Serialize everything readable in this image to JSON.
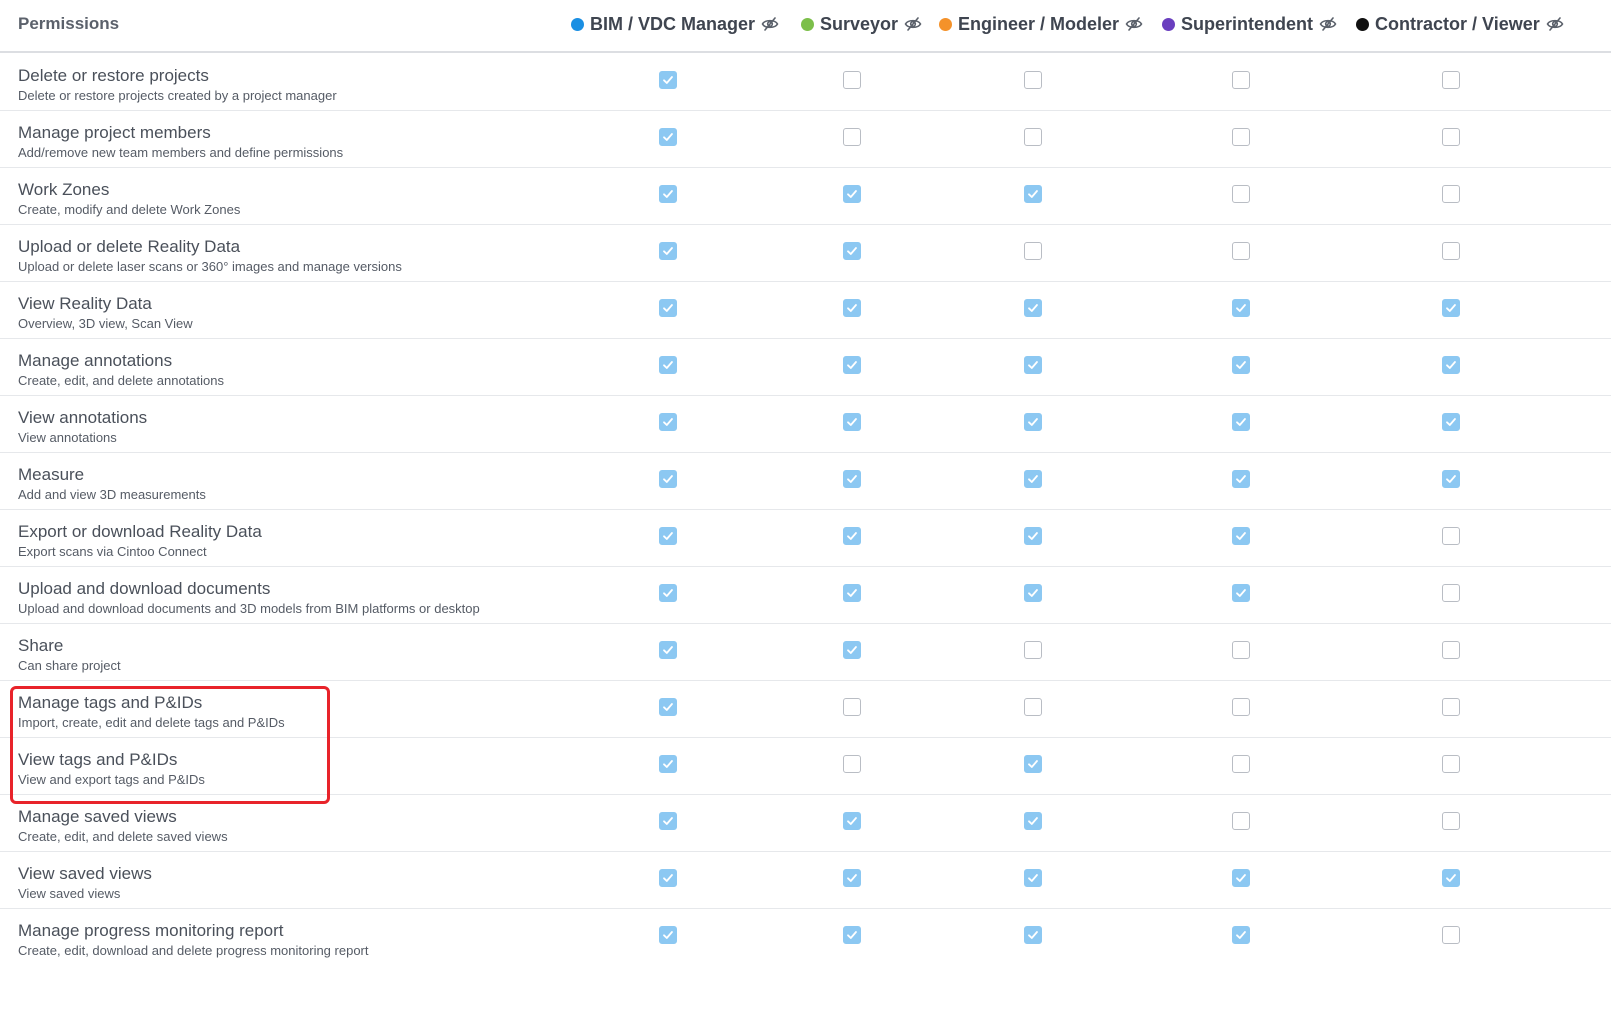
{
  "header": {
    "title": "Permissions",
    "roles": [
      {
        "name": "BIM / VDC Manager",
        "color": "#1a8fe3",
        "icon": "eye-slash-icon"
      },
      {
        "name": "Surveyor",
        "color": "#7cbf4a",
        "icon": "eye-slash-icon"
      },
      {
        "name": "Engineer / Modeler",
        "color": "#f4922a",
        "icon": "eye-slash-icon"
      },
      {
        "name": "Superintendent",
        "color": "#6a3fbf",
        "icon": "eye-slash-icon"
      },
      {
        "name": "Contractor / Viewer",
        "color": "#111111",
        "icon": "eye-slash-icon"
      }
    ]
  },
  "colors": {
    "checked": "#8cc8f2",
    "unchecked_border": "#b9bdc4",
    "highlight": "#e8232a"
  },
  "permissions": [
    {
      "name": "Delete or restore projects",
      "desc": "Delete or restore projects created by a project manager",
      "checks": [
        true,
        false,
        false,
        false,
        false
      ]
    },
    {
      "name": "Manage project members",
      "desc": "Add/remove new team members and define permissions",
      "checks": [
        true,
        false,
        false,
        false,
        false
      ]
    },
    {
      "name": "Work Zones",
      "desc": "Create, modify and delete Work Zones",
      "checks": [
        true,
        true,
        true,
        false,
        false
      ]
    },
    {
      "name": "Upload or delete Reality Data",
      "desc": "Upload or delete laser scans or 360° images and manage versions",
      "checks": [
        true,
        true,
        false,
        false,
        false
      ]
    },
    {
      "name": "View Reality Data",
      "desc": "Overview, 3D view, Scan View",
      "checks": [
        true,
        true,
        true,
        true,
        true
      ]
    },
    {
      "name": "Manage annotations",
      "desc": "Create, edit, and delete annotations",
      "checks": [
        true,
        true,
        true,
        true,
        true
      ]
    },
    {
      "name": "View annotations",
      "desc": "View annotations",
      "checks": [
        true,
        true,
        true,
        true,
        true
      ]
    },
    {
      "name": "Measure",
      "desc": "Add and view 3D measurements",
      "checks": [
        true,
        true,
        true,
        true,
        true
      ]
    },
    {
      "name": "Export or download Reality Data",
      "desc": "Export scans via Cintoo Connect",
      "checks": [
        true,
        true,
        true,
        true,
        false
      ]
    },
    {
      "name": "Upload and download documents",
      "desc": "Upload and download documents and 3D models from BIM platforms or desktop",
      "checks": [
        true,
        true,
        true,
        true,
        false
      ]
    },
    {
      "name": "Share",
      "desc": "Can share project",
      "checks": [
        true,
        true,
        false,
        false,
        false
      ]
    },
    {
      "name": "Manage tags and P&IDs",
      "desc": "Import, create, edit and delete tags and P&IDs",
      "checks": [
        true,
        false,
        false,
        false,
        false
      ]
    },
    {
      "name": "View tags and P&IDs",
      "desc": "View and export tags and P&IDs",
      "checks": [
        true,
        false,
        true,
        false,
        false
      ]
    },
    {
      "name": "Manage saved views",
      "desc": "Create, edit, and delete saved views",
      "checks": [
        true,
        true,
        true,
        false,
        false
      ]
    },
    {
      "name": "View saved views",
      "desc": "View saved views",
      "checks": [
        true,
        true,
        true,
        true,
        true
      ]
    },
    {
      "name": "Manage progress monitoring report",
      "desc": "Create, edit, download and delete progress monitoring report",
      "checks": [
        true,
        true,
        true,
        true,
        false
      ]
    }
  ]
}
